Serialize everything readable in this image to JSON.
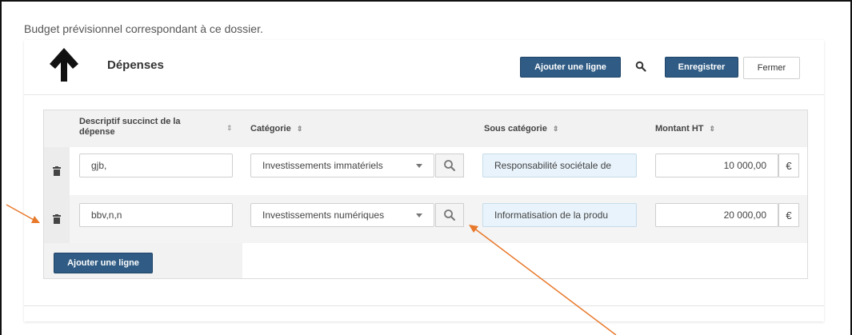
{
  "intro_text": "Budget prévisionnel correspondant à ce dossier.",
  "header": {
    "title": "Dépenses",
    "add_line_label": "Ajouter une ligne",
    "save_label": "Enregistrer",
    "close_label": "Fermer"
  },
  "table": {
    "columns": {
      "descriptif_line1": "Descriptif succinct de la",
      "descriptif_line2": "dépense",
      "categorie": "Catégorie",
      "sous_categorie": "Sous catégorie",
      "montant": "Montant HT"
    },
    "rows": [
      {
        "descriptif": "gjb,",
        "categorie": "Investissements immatériels",
        "sous_categorie": "Responsabilité sociétale de",
        "montant": "10 000,00",
        "currency": "€"
      },
      {
        "descriptif": "bbv,n,n",
        "categorie": "Investissements numériques",
        "sous_categorie": "Informatisation de la produ",
        "montant": "20 000,00",
        "currency": "€"
      }
    ],
    "footer_add_line_label": "Ajouter une ligne"
  },
  "colors": {
    "primary_button": "#2f5b84",
    "annotation_arrow": "#e8782a",
    "readonly_field": "#e8f3fb"
  },
  "icons": [
    "arrow-up-icon",
    "search-icon",
    "trash-icon",
    "sort-icon",
    "chevron-down-icon"
  ]
}
